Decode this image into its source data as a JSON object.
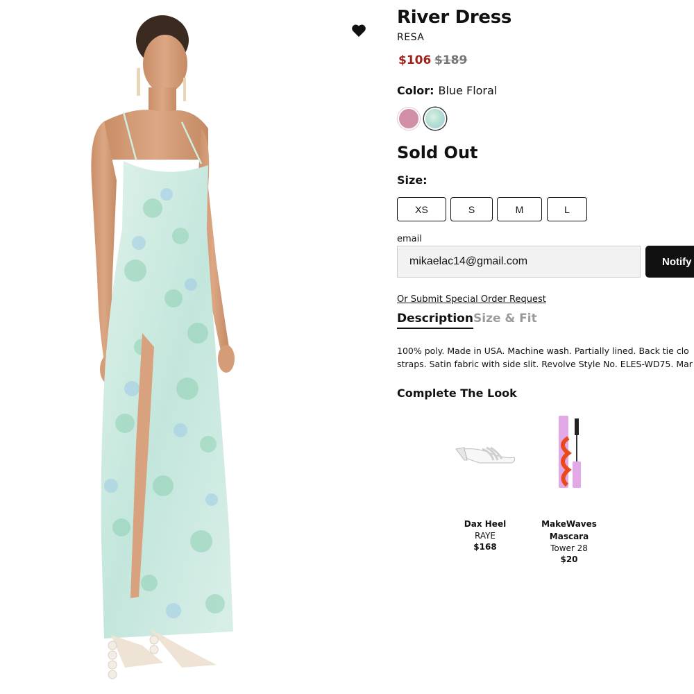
{
  "product": {
    "title": "River Dress",
    "brand": "RESA",
    "price_sale": "$106",
    "price_original": "$189",
    "color_label": "Color:",
    "color_value": "Blue Floral",
    "swatches": [
      "#d18ea7",
      "#b7e0d2"
    ],
    "availability": "Sold Out",
    "size_label": "Size:",
    "sizes": [
      "XS",
      "S",
      "M",
      "L"
    ]
  },
  "notify": {
    "email_label": "email",
    "email_value": "mikaelac14@gmail.com",
    "button_label": "Notify"
  },
  "special_order_link": "Or Submit Special Order Request",
  "tabs": [
    {
      "label": "Description",
      "active": true
    },
    {
      "label": "Size & Fit",
      "active": false
    }
  ],
  "description": [
    "100% poly. Made in USA. Machine wash. Partially lined. Back tie clo",
    "straps. Satin fabric with side slit. Revolve Style No. ELES-WD75. Mar"
  ],
  "complete_the_look": {
    "title": "Complete The Look",
    "items": [
      {
        "name": "Dax Heel",
        "brand": "RAYE",
        "price": "$168"
      },
      {
        "name": "MakeWaves Mascara",
        "brand": "Tower 28",
        "price": "$20"
      }
    ]
  },
  "colors": {
    "sale_price": "#a0221d",
    "button_bg": "#111111"
  }
}
